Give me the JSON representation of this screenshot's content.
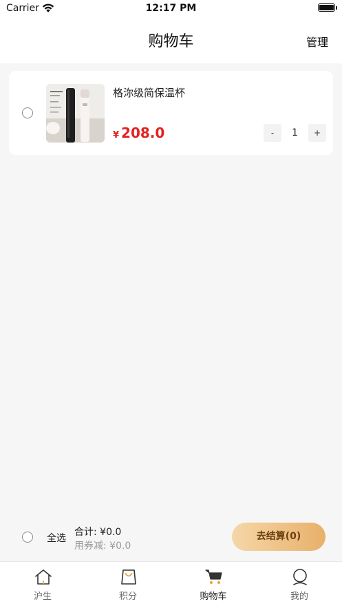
{
  "status_bar": {
    "carrier": "Carrier",
    "time": "12:17 PM"
  },
  "nav": {
    "title": "购物车",
    "manage_label": "管理"
  },
  "cart": {
    "items": [
      {
        "name": "格沵级简保温杯",
        "price_symbol": "¥",
        "price": "208.0",
        "quantity": "1",
        "minus_label": "-",
        "plus_label": "+"
      }
    ]
  },
  "checkout": {
    "select_all_label": "全选",
    "total_label": "合计:",
    "total_value": "¥0.0",
    "coupon_label": "用券减:",
    "coupon_value": "¥0.0",
    "button_label": "去结算(0)"
  },
  "tabs": [
    {
      "label": "沪生",
      "icon": "home-icon"
    },
    {
      "label": "积分",
      "icon": "bag-icon"
    },
    {
      "label": "购物车",
      "icon": "cart-icon",
      "active": true
    },
    {
      "label": "我的",
      "icon": "profile-icon"
    }
  ],
  "colors": {
    "price": "#e32121",
    "checkout_gradient_start": "#f5d7a8",
    "checkout_gradient_end": "#e8b06a",
    "bag_accent": "#e8a33a"
  }
}
